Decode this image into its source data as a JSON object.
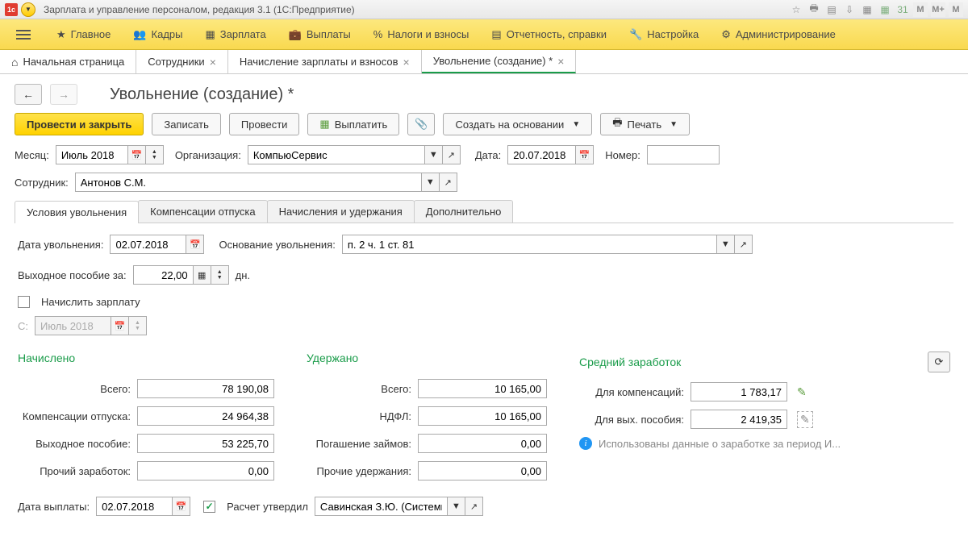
{
  "window_title": "Зарплата и управление персоналом, редакция 3.1  (1С:Предприятие)",
  "mainmenu": [
    "Главное",
    "Кадры",
    "Зарплата",
    "Выплаты",
    "Налоги и взносы",
    "Отчетность, справки",
    "Настройка",
    "Администрирование"
  ],
  "tabs": {
    "home": "Начальная страница",
    "items": [
      "Сотрудники",
      "Начисление зарплаты и взносов",
      "Увольнение (создание) *"
    ],
    "active_index": 2
  },
  "page_title": "Увольнение (создание) *",
  "toolbar": {
    "post_close": "Провести и закрыть",
    "save": "Записать",
    "post": "Провести",
    "pay": "Выплатить",
    "create_based": "Создать на основании",
    "print": "Печать"
  },
  "header": {
    "month_label": "Месяц:",
    "month": "Июль 2018",
    "org_label": "Организация:",
    "org": "КомпьюСервис",
    "date_label": "Дата:",
    "date": "20.07.2018",
    "number_label": "Номер:",
    "number": "",
    "employee_label": "Сотрудник:",
    "employee": "Антонов С.М."
  },
  "subtabs": [
    "Условия увольнения",
    "Компенсации отпуска",
    "Начисления и удержания",
    "Дополнительно"
  ],
  "conditions": {
    "fire_date_label": "Дата увольнения:",
    "fire_date": "02.07.2018",
    "basis_label": "Основание увольнения:",
    "basis": "п. 2 ч. 1 ст. 81",
    "severance_label": "Выходное пособие за:",
    "severance_days": "22,00",
    "severance_unit": "дн.",
    "accrue_salary_label": "Начислить зарплату",
    "from_label": "С:",
    "from_month": "Июль 2018"
  },
  "calc": {
    "accrued_title": "Начислено",
    "withheld_title": "Удержано",
    "avg_title": "Средний заработок",
    "rows": {
      "total_label": "Всего:",
      "total": "78 190,08",
      "vacation_comp_label": "Компенсации отпуска:",
      "vacation_comp": "24 964,38",
      "severance_label": "Выходное пособие:",
      "severance": "53 225,70",
      "other_inc_label": "Прочий заработок:",
      "other_inc": "0,00",
      "withheld_total_label": "Всего:",
      "withheld_total": "10 165,00",
      "ndfl_label": "НДФЛ:",
      "ndfl": "10 165,00",
      "loans_label": "Погашение займов:",
      "loans": "0,00",
      "other_ded_label": "Прочие удержания:",
      "other_ded": "0,00",
      "for_comp_label": "Для компенсаций:",
      "for_comp": "1 783,17",
      "for_sev_label": "Для вых. пособия:",
      "for_sev": "2 419,35",
      "info_text": "Использованы данные о заработке за период И..."
    }
  },
  "footer": {
    "payment_date_label": "Дата выплаты:",
    "payment_date": "02.07.2018",
    "approved_label": "Расчет утвердил",
    "approver": "Савинская З.Ю. (Системны"
  }
}
